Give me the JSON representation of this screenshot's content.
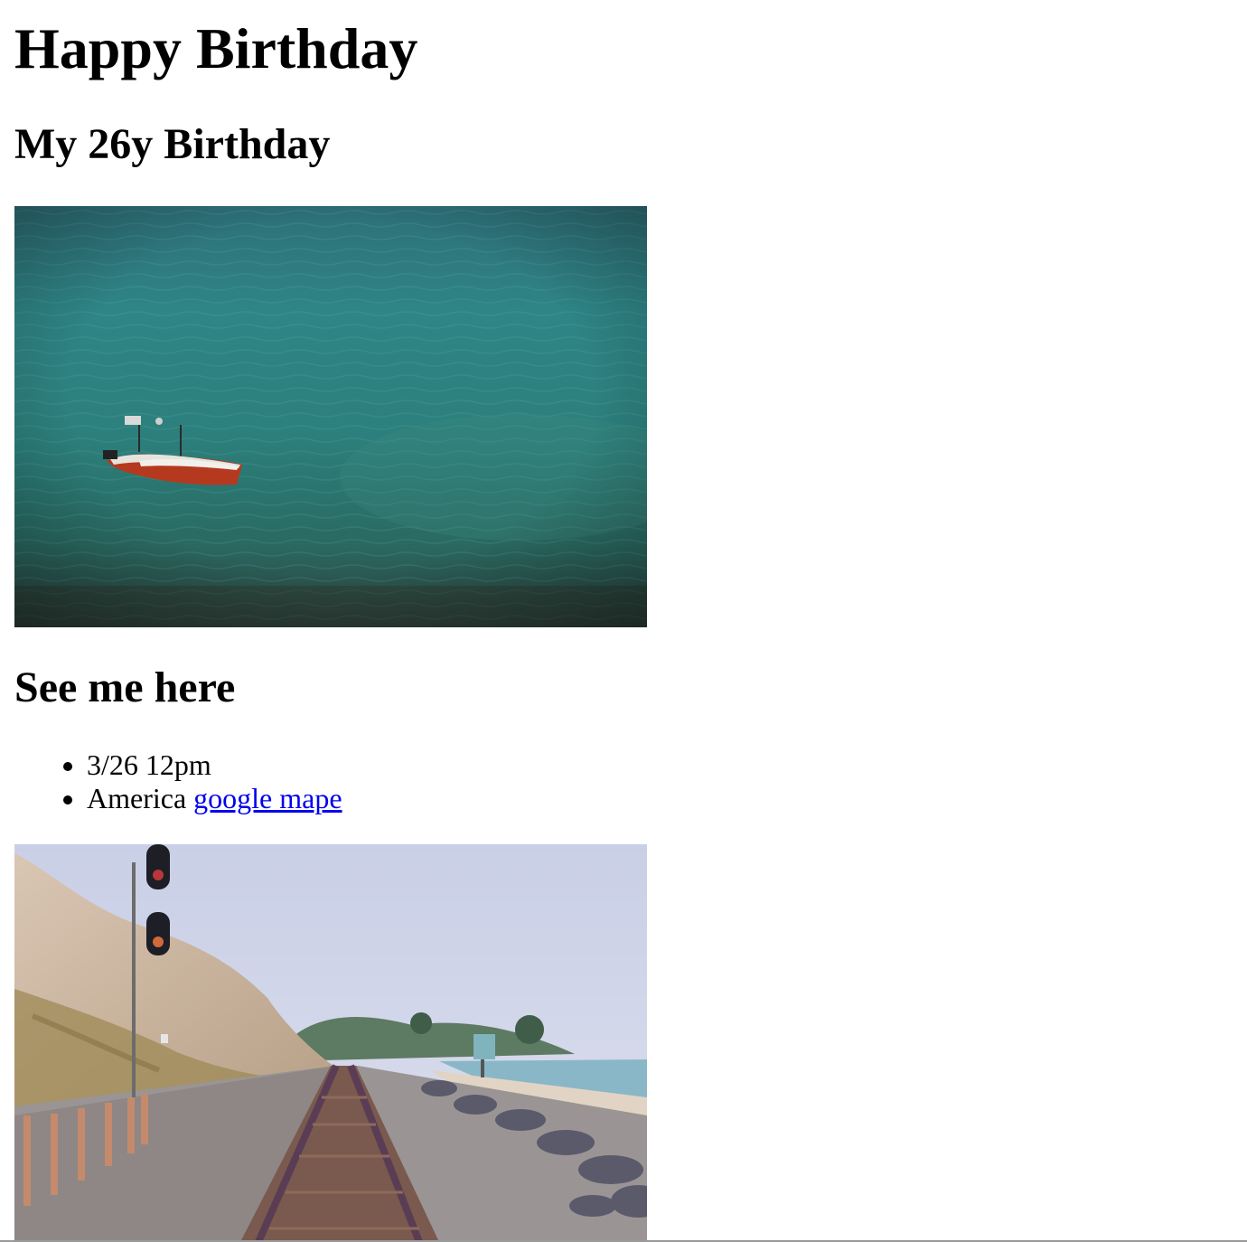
{
  "page": {
    "title": "Happy Birthday",
    "subtitle": "My 26y Birthday",
    "section_title": "See me here",
    "details": {
      "time": "3/26 12pm",
      "location_text": "America",
      "map_link_label": "google mape"
    }
  },
  "images": {
    "boat": {
      "alt": "Small red rowboat on turquoise water"
    },
    "railway": {
      "alt": "Railway track along the beach beside cliffs"
    }
  },
  "colors": {
    "link": "#0000ee",
    "text": "#000000",
    "background": "#ffffff"
  }
}
